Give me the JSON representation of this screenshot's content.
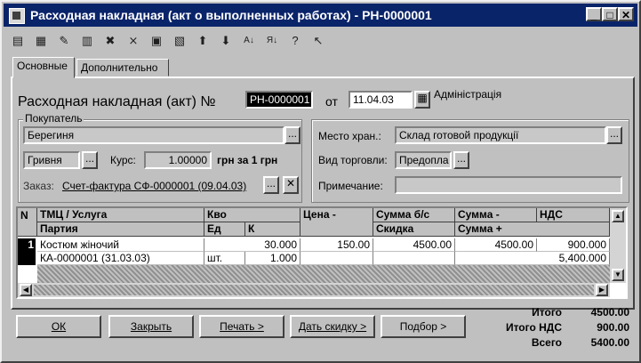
{
  "window": {
    "title": "Расходная накладная (акт о выполненных работах) - РН-0000001",
    "min": "_",
    "max": "□",
    "close": "✕"
  },
  "tabs": [
    {
      "label": "Основные"
    },
    {
      "label": "Дополнительно"
    }
  ],
  "header": {
    "doc_title": "Расходная накладная (акт) №",
    "doc_number": "РН-0000001",
    "date_label": "от",
    "date_value": "11.04.03",
    "org": "Адміністрація"
  },
  "customer": {
    "group_label": "Покупатель",
    "name": "Берегиня",
    "currency": "Гривня",
    "rate_label": "Курс:",
    "rate_value": "1.00000",
    "rate_unit": "грн за 1 грн",
    "order_label": "Заказ:",
    "order_link": "Счет-фактура СФ-0000001 (09.04.03)"
  },
  "right": {
    "warehouse_label": "Место хран.:",
    "warehouse_value": "Склад готовой продукції",
    "trade_label": "Вид торговли:",
    "trade_value": "Предопла",
    "note_label": "Примечание:",
    "note_value": ""
  },
  "table": {
    "headers": {
      "n": "N",
      "item": "ТМЦ / Услуга",
      "batch": "Партия",
      "qty": "Кво",
      "unit": "Ед",
      "k": "К",
      "price": "Цена -",
      "sum_wo": "Сумма б/с",
      "discount": "Скидка",
      "sum": "Сумма -",
      "vat": "НДС",
      "sum_plus": "Сумма +"
    },
    "rows": [
      {
        "n": "1",
        "item": "Костюм жіночий",
        "batch": "КА-0000001 (31.03.03)",
        "qty": "30.000",
        "unit": "шт.",
        "k": "1.000",
        "price": "150.00",
        "sum_wo": "4500.00",
        "discount": "",
        "sum": "4500.00",
        "vat": "900.000",
        "sum_plus": "5,400.000"
      }
    ]
  },
  "buttons": {
    "ok": "ОК",
    "close": "Закрыть",
    "print": "Печать >",
    "discount": "Дать скидку >",
    "pick": "Подбор >"
  },
  "totals": {
    "total_label": "Итого",
    "total_value": "4500.00",
    "vat_label": "Итого НДС",
    "vat_value": "900.00",
    "all_label": "Всего",
    "all_value": "5400.00"
  }
}
